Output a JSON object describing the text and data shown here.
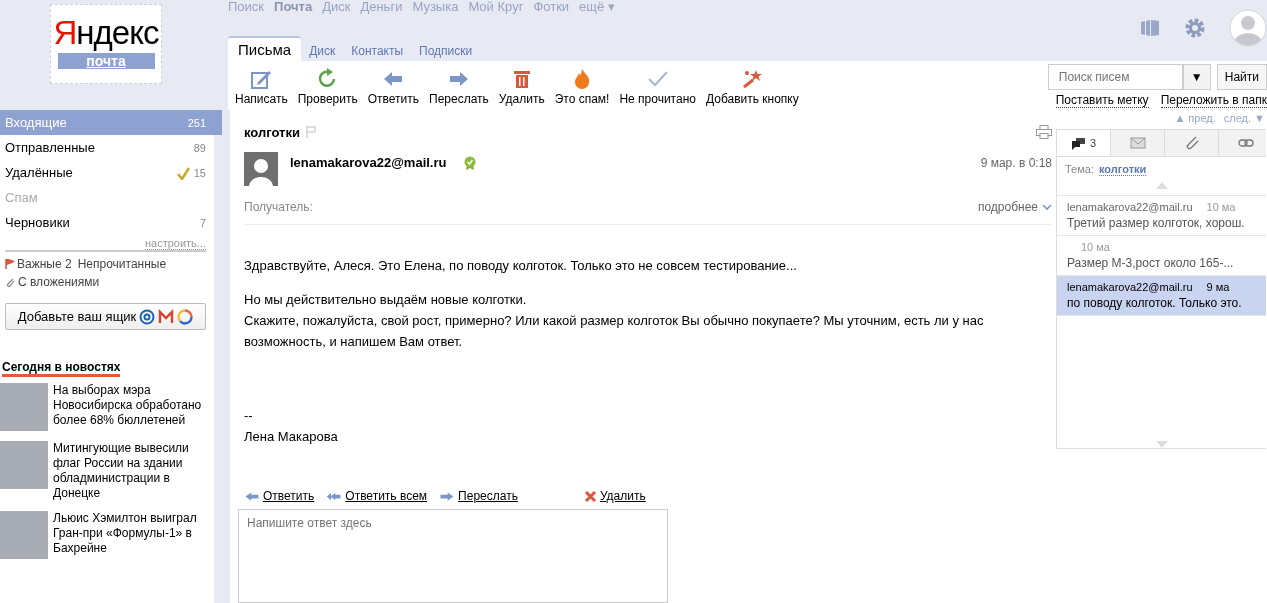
{
  "logo": {
    "wordmark": "Яндекс",
    "service": "почта"
  },
  "top_nav": [
    {
      "label": "Поиск",
      "selected": false
    },
    {
      "label": "Почта",
      "selected": true
    },
    {
      "label": "Диск",
      "selected": false
    },
    {
      "label": "Деньги",
      "selected": false
    },
    {
      "label": "Музыка",
      "selected": false
    },
    {
      "label": "Мой Круг",
      "selected": false
    },
    {
      "label": "Фотки",
      "selected": false
    },
    {
      "label": "ещё ▾",
      "selected": false
    }
  ],
  "tabs": [
    {
      "label": "Письма",
      "selected": true
    },
    {
      "label": "Диск",
      "selected": false
    },
    {
      "label": "Контакты",
      "selected": false
    },
    {
      "label": "Подписки",
      "selected": false
    }
  ],
  "toolbar": [
    {
      "kind": "compose",
      "label": "Написать"
    },
    {
      "kind": "refresh",
      "label": "Проверить"
    },
    {
      "kind": "reply",
      "label": "Ответить"
    },
    {
      "kind": "forward",
      "label": "Переслать"
    },
    {
      "kind": "delete",
      "label": "Удалить"
    },
    {
      "kind": "spam",
      "label": "Это спам!"
    },
    {
      "kind": "unread",
      "label": "Не прочитано"
    },
    {
      "kind": "add",
      "label": "Добавить кнопку"
    }
  ],
  "search": {
    "placeholder": "Поиск писем",
    "dropdown": "▼",
    "button": "Найти",
    "links": [
      "Поставить метку",
      "Переложить в папк"
    ]
  },
  "sidebar": {
    "folders": [
      {
        "name": "Входящие",
        "count": "251",
        "selected": true,
        "disabled": false,
        "clean_icon": false
      },
      {
        "name": "Отправленные",
        "count": "89",
        "selected": false,
        "disabled": false,
        "clean_icon": false
      },
      {
        "name": "Удалённые",
        "count": "15",
        "selected": false,
        "disabled": false,
        "clean_icon": true
      },
      {
        "name": "Спам",
        "selected": false,
        "disabled": true,
        "clean_icon": false
      },
      {
        "name": "Черновики",
        "count": "7",
        "selected": false,
        "disabled": false,
        "clean_icon": false
      }
    ],
    "configure": "настроить...",
    "important": "Важные 2",
    "unread": "Непрочитанные",
    "attachments": "С вложениями",
    "add_mailbox": "Добавьте ваш ящик",
    "news_title": "Сегодня в новостях",
    "news": [
      {
        "title": "На выборах мэра Новосибирска обработано более 68% бюллетеней"
      },
      {
        "title": "Митингующие вывесили флаг России на здании обладминистрации в Донецке"
      },
      {
        "title": "Льюис Хэмилтон выиграл Гран-при «Формулы-1» в Бахрейне"
      }
    ]
  },
  "message": {
    "subject": "колготки",
    "sender": "lenamakarova22@mail.ru",
    "date": "9 мар. в 0:18",
    "recipient_label": "Получатель:",
    "details": "подробнее",
    "body": [
      [
        "Здравствуйте, Алеся. Это Елена, по поводу колготок. Только это не совсем тестирование..."
      ],
      [
        "Но мы действительно выдаём новые колготки.",
        "Скажите, пожалуйста, свой рост, примерно? Или какой размер колготок Вы обычно покупаете? Мы уточним, есть ли у нас возможность, и напишем Вам ответ."
      ],
      [
        "--",
        "Лена Макарова"
      ]
    ],
    "actions": [
      {
        "kind": "reply",
        "label": "Ответить"
      },
      {
        "kind": "reply_all",
        "label": "Ответить всем"
      },
      {
        "kind": "forward",
        "label": "Переслать"
      },
      {
        "kind": "delete",
        "label": "Удалить"
      }
    ],
    "reply_placeholder": "Напишите ответ здесь"
  },
  "thread": {
    "prev": "▲ пред.",
    "next": "след. ▼",
    "tabs": [
      {
        "kind": "conversation",
        "count": "3",
        "selected": true
      },
      {
        "kind": "mail",
        "selected": false
      },
      {
        "kind": "attachment",
        "selected": false
      },
      {
        "kind": "link",
        "selected": false
      }
    ],
    "topic_label": "Тема:",
    "topic": "колготки",
    "messages": [
      {
        "from": "lenamakarova22@mail.ru",
        "date": "10 ма",
        "snippet": "Третий размер колготок, хорош.",
        "selected": false
      },
      {
        "date": "10 ма",
        "snippet": "Размер М-3,рост около 165-...",
        "selected": false
      },
      {
        "from": "lenamakarova22@mail.ru",
        "date": "9 ма",
        "snippet": "по поводу колготок. Только это.",
        "selected": true
      }
    ]
  }
}
